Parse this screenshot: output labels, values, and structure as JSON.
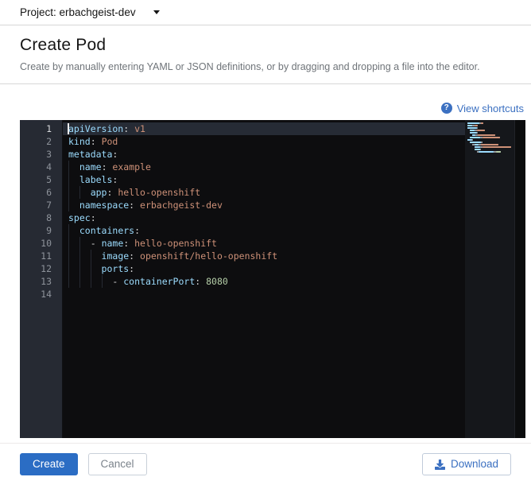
{
  "colors": {
    "primary_blue": "#2b6dc4",
    "link_blue": "#3b70c1",
    "editor_bg": "#0d0d0f",
    "gutter_bg": "#262a33",
    "minimap_bg": "#15171b",
    "tok_key": "#9cdcfe",
    "tok_str": "#ce9178",
    "tok_num": "#b5cea8",
    "tok_punc": "#d4d4d4"
  },
  "project_bar": {
    "label": "Project: erbachgeist-dev"
  },
  "header": {
    "title": "Create Pod",
    "subtitle": "Create by manually entering YAML or JSON definitions, or by dragging and dropping a file into the editor."
  },
  "editor": {
    "shortcuts_label": "View shortcuts",
    "help_glyph": "?",
    "active_line": 1,
    "lines": [
      {
        "n": 1,
        "tokens": [
          [
            "key",
            "apiVersion"
          ],
          [
            "punc",
            ": "
          ],
          [
            "str",
            "v1"
          ]
        ]
      },
      {
        "n": 2,
        "tokens": [
          [
            "key",
            "kind"
          ],
          [
            "punc",
            ": "
          ],
          [
            "str",
            "Pod"
          ]
        ]
      },
      {
        "n": 3,
        "tokens": [
          [
            "key",
            "metadata"
          ],
          [
            "punc",
            ":"
          ]
        ]
      },
      {
        "n": 4,
        "tokens": [
          [
            "ws",
            "  "
          ],
          [
            "key",
            "name"
          ],
          [
            "punc",
            ": "
          ],
          [
            "str",
            "example"
          ]
        ]
      },
      {
        "n": 5,
        "tokens": [
          [
            "ws",
            "  "
          ],
          [
            "key",
            "labels"
          ],
          [
            "punc",
            ":"
          ]
        ]
      },
      {
        "n": 6,
        "tokens": [
          [
            "ws",
            "    "
          ],
          [
            "key",
            "app"
          ],
          [
            "punc",
            ": "
          ],
          [
            "str",
            "hello-openshift"
          ]
        ]
      },
      {
        "n": 7,
        "tokens": [
          [
            "ws",
            "  "
          ],
          [
            "key",
            "namespace"
          ],
          [
            "punc",
            ": "
          ],
          [
            "str",
            "erbachgeist-dev"
          ]
        ]
      },
      {
        "n": 8,
        "tokens": [
          [
            "key",
            "spec"
          ],
          [
            "punc",
            ":"
          ]
        ]
      },
      {
        "n": 9,
        "tokens": [
          [
            "ws",
            "  "
          ],
          [
            "key",
            "containers"
          ],
          [
            "punc",
            ":"
          ]
        ]
      },
      {
        "n": 10,
        "tokens": [
          [
            "ws",
            "    "
          ],
          [
            "punc",
            "- "
          ],
          [
            "key",
            "name"
          ],
          [
            "punc",
            ": "
          ],
          [
            "str",
            "hello-openshift"
          ]
        ]
      },
      {
        "n": 11,
        "tokens": [
          [
            "ws",
            "      "
          ],
          [
            "key",
            "image"
          ],
          [
            "punc",
            ": "
          ],
          [
            "str",
            "openshift/hello-openshift"
          ]
        ]
      },
      {
        "n": 12,
        "tokens": [
          [
            "ws",
            "      "
          ],
          [
            "key",
            "ports"
          ],
          [
            "punc",
            ":"
          ]
        ]
      },
      {
        "n": 13,
        "tokens": [
          [
            "ws",
            "        "
          ],
          [
            "punc",
            "- "
          ],
          [
            "key",
            "containerPort"
          ],
          [
            "punc",
            ": "
          ],
          [
            "num",
            "8080"
          ]
        ]
      },
      {
        "n": 14,
        "tokens": []
      }
    ]
  },
  "footer": {
    "create_label": "Create",
    "cancel_label": "Cancel",
    "download_label": "Download"
  }
}
